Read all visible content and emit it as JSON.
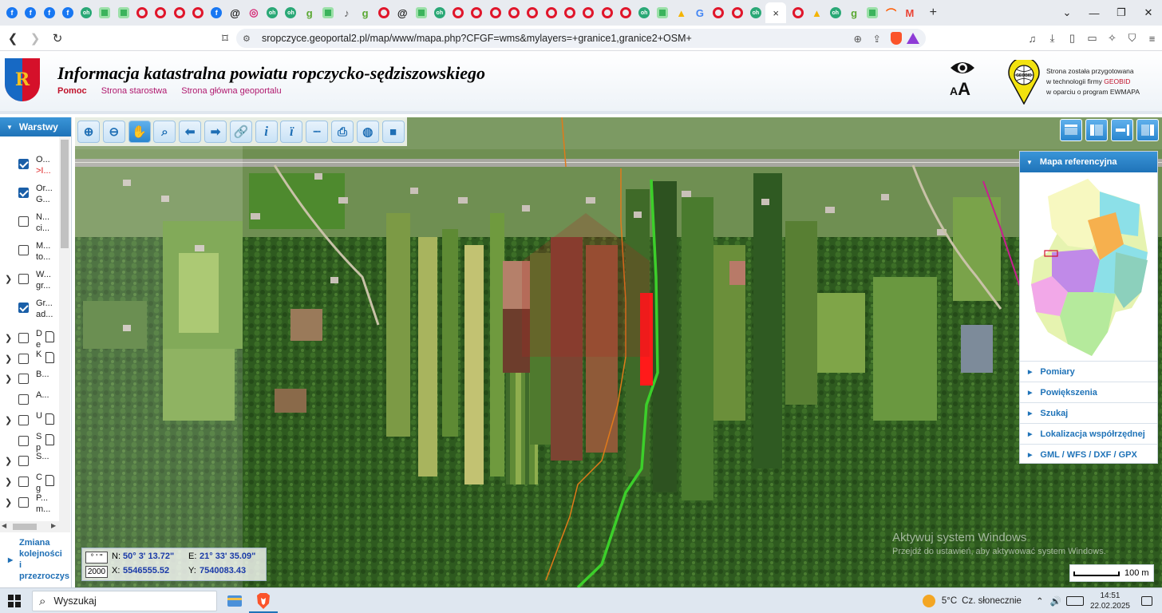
{
  "browser": {
    "active_tab_close": "×",
    "new_tab": "+",
    "url": "sropczyce.geoportal2.pl/map/www/mapa.php?CFGF=wms&mylayers=+granice1,granice2+OSM+",
    "tab_icons": [
      {
        "name": "facebook",
        "color": "#1877f2",
        "glyph": "f"
      },
      {
        "name": "facebook",
        "color": "#1877f2",
        "glyph": "f"
      },
      {
        "name": "facebook",
        "color": "#1877f2",
        "glyph": "f"
      },
      {
        "name": "facebook",
        "color": "#1877f2",
        "glyph": "f"
      },
      {
        "name": "otodom",
        "color": "#2aa876",
        "glyph": "oh"
      },
      {
        "name": "green-square",
        "color": "#3bb35c",
        "glyph": "■"
      },
      {
        "name": "green-square",
        "color": "#3bb35c",
        "glyph": "■"
      },
      {
        "name": "opera-ring",
        "color": "#e0162b",
        "glyph": "o"
      },
      {
        "name": "opera-ring",
        "color": "#e0162b",
        "glyph": "o"
      },
      {
        "name": "opera-ring",
        "color": "#e0162b",
        "glyph": "o"
      },
      {
        "name": "opera-ring",
        "color": "#e0162b",
        "glyph": "o"
      },
      {
        "name": "facebook",
        "color": "#1877f2",
        "glyph": "f"
      },
      {
        "name": "threads",
        "color": "#111111",
        "glyph": "@"
      },
      {
        "name": "instagram",
        "color": "#d62976",
        "glyph": "◎"
      },
      {
        "name": "otodom",
        "color": "#2aa876",
        "glyph": "oh"
      },
      {
        "name": "otodom",
        "color": "#2aa876",
        "glyph": "oh"
      },
      {
        "name": "gratka",
        "color": "#5aa832",
        "glyph": "g"
      },
      {
        "name": "green-square",
        "color": "#3bb35c",
        "glyph": "■"
      },
      {
        "name": "audio",
        "color": "#555555",
        "glyph": "♪"
      },
      {
        "name": "gratka",
        "color": "#5aa832",
        "glyph": "g"
      },
      {
        "name": "opera-ring",
        "color": "#e0162b",
        "glyph": "o"
      },
      {
        "name": "threads",
        "color": "#111111",
        "glyph": "@"
      },
      {
        "name": "green-square",
        "color": "#3bb35c",
        "glyph": "■"
      },
      {
        "name": "otodom",
        "color": "#2aa876",
        "glyph": "oh"
      },
      {
        "name": "opera-ring",
        "color": "#e0162b",
        "glyph": "o"
      },
      {
        "name": "opera-ring",
        "color": "#e0162b",
        "glyph": "o"
      },
      {
        "name": "opera-ring",
        "color": "#e0162b",
        "glyph": "o"
      },
      {
        "name": "opera-ring",
        "color": "#e0162b",
        "glyph": "o"
      },
      {
        "name": "opera-ring",
        "color": "#e0162b",
        "glyph": "o"
      },
      {
        "name": "opera-ring",
        "color": "#e0162b",
        "glyph": "o"
      },
      {
        "name": "opera-ring",
        "color": "#e0162b",
        "glyph": "o"
      },
      {
        "name": "opera-ring",
        "color": "#e0162b",
        "glyph": "o"
      },
      {
        "name": "opera-ring",
        "color": "#e0162b",
        "glyph": "o"
      },
      {
        "name": "opera-ring",
        "color": "#e0162b",
        "glyph": "o"
      },
      {
        "name": "otodom",
        "color": "#2aa876",
        "glyph": "oh"
      },
      {
        "name": "green-square",
        "color": "#3bb35c",
        "glyph": "■"
      },
      {
        "name": "google-drive",
        "color": "#f4b400",
        "glyph": "▲"
      },
      {
        "name": "google",
        "color": "#4285f4",
        "glyph": "G"
      },
      {
        "name": "opera-ring",
        "color": "#e0162b",
        "glyph": "o"
      },
      {
        "name": "opera-ring",
        "color": "#e0162b",
        "glyph": "o"
      },
      {
        "name": "otodom",
        "color": "#2aa876",
        "glyph": "oh"
      }
    ],
    "tab_icons_after": [
      {
        "name": "opera-ring",
        "color": "#e0162b",
        "glyph": "o"
      },
      {
        "name": "google-drive",
        "color": "#f4b400",
        "glyph": "▲"
      },
      {
        "name": "otodom",
        "color": "#2aa876",
        "glyph": "oh"
      },
      {
        "name": "gratka",
        "color": "#5aa832",
        "glyph": "g"
      },
      {
        "name": "green-square",
        "color": "#3bb35c",
        "glyph": "■"
      },
      {
        "name": "allegro",
        "color": "#ff5a00",
        "glyph": "⌒"
      },
      {
        "name": "gmail",
        "color": "#ea4335",
        "glyph": "M"
      }
    ]
  },
  "header": {
    "title": "Informacja katastralna powiatu ropczycko-sędziszowskiego",
    "links": [
      "Pomoc",
      "Strona starostwa",
      "Strona główna geoportalu"
    ],
    "accessibility_small": "A",
    "accessibility_big": "A",
    "geobid_line1": "Strona została przygotowana",
    "geobid_line2_prefix": "w technologii firmy ",
    "geobid_line2_brand": "GEOBID",
    "geobid_line3": "w oparciu o program EWMAPA",
    "geobid_logo_text": "GEOBID"
  },
  "layers_panel": {
    "title": "Warstwy",
    "layers": [
      {
        "expand": false,
        "checked": true,
        "doc": false,
        "t1": "O...",
        "t2": ">I...",
        "t2_red": true
      },
      {
        "expand": false,
        "checked": true,
        "doc": false,
        "t1": "Or...",
        "t2": "G..."
      },
      {
        "expand": false,
        "checked": false,
        "doc": false,
        "t1": "N...",
        "t2": "ci..."
      },
      {
        "expand": false,
        "checked": false,
        "doc": false,
        "t1": "M...",
        "t2": "to..."
      },
      {
        "expand": true,
        "checked": false,
        "doc": false,
        "t1": "W...",
        "t2": "gr..."
      },
      {
        "expand": false,
        "checked": true,
        "doc": false,
        "t1": "Gr...",
        "t2": "ad..."
      },
      {
        "expand": true,
        "checked": false,
        "doc": true,
        "t1": "D",
        "t2": "e"
      },
      {
        "expand": true,
        "checked": false,
        "doc": true,
        "t1": "K",
        "t2": ""
      },
      {
        "expand": true,
        "checked": false,
        "doc": false,
        "t1": "B...",
        "t2": ""
      },
      {
        "expand": false,
        "checked": false,
        "doc": false,
        "t1": "A...",
        "t2": ""
      },
      {
        "expand": true,
        "checked": false,
        "doc": true,
        "t1": "U",
        "t2": ""
      },
      {
        "expand": false,
        "checked": false,
        "doc": true,
        "t1": "S",
        "t2": "p"
      },
      {
        "expand": true,
        "checked": false,
        "doc": false,
        "t1": "S...",
        "t2": ""
      },
      {
        "expand": true,
        "checked": false,
        "doc": true,
        "t1": "C",
        "t2": "g"
      },
      {
        "expand": true,
        "checked": false,
        "doc": false,
        "t1": "P...",
        "t2": "m..."
      }
    ],
    "bottom_link": [
      "Zmiana",
      "kolejności",
      "i",
      "przezroczys"
    ]
  },
  "toolbar": {
    "tools": [
      {
        "name": "zoom-in-button",
        "glyph": "⊕"
      },
      {
        "name": "zoom-out-button",
        "glyph": "⊖"
      },
      {
        "name": "pan-button",
        "glyph": "✋",
        "active": true
      },
      {
        "name": "zoom-extent-button",
        "glyph": "⌕"
      },
      {
        "name": "back-button",
        "glyph": "⬅"
      },
      {
        "name": "forward-button",
        "glyph": "➡"
      },
      {
        "name": "link-button",
        "glyph": "🔗"
      },
      {
        "name": "info-button",
        "glyph": "i"
      },
      {
        "name": "info-extended-button",
        "glyph": "ï"
      },
      {
        "name": "measure-button",
        "glyph": "┈"
      },
      {
        "name": "print-button",
        "glyph": "⎙"
      },
      {
        "name": "globe-button",
        "glyph": "◍"
      },
      {
        "name": "video-button",
        "glyph": "■"
      }
    ]
  },
  "ref_panel": {
    "title": "Mapa referencyjna",
    "sections": [
      "Pomiary",
      "Powiększenia",
      "Szukaj",
      "Lokalizacja współrzędnej",
      "GML / WFS / DXF / GPX"
    ]
  },
  "coords": {
    "dms_button": "° ' \"",
    "epsg_button": "2000",
    "n_label": "N:",
    "n_value": "50° 3' 13.72\"",
    "e_label": "E:",
    "e_value": "21° 33' 35.09\"",
    "x_label": "X:",
    "x_value": "5546555.52",
    "y_label": "Y:",
    "y_value": "7540083.43"
  },
  "scale": {
    "label": "100 m"
  },
  "watermark": {
    "line1": "Aktywuj system Windows",
    "line2": "Przejdź do ustawień, aby aktywować system Windows."
  },
  "taskbar": {
    "search_placeholder": "Wyszukaj",
    "temp": "5°C",
    "weather": "Cz. słonecznie",
    "time": "14:51",
    "date": "22.02.2025"
  },
  "colors": {
    "accent_blue": "#1f73b8",
    "parcel_red": "#ff1a1a",
    "boundary_green": "#3ccf2a",
    "boundary_orange": "#e07a1a"
  }
}
